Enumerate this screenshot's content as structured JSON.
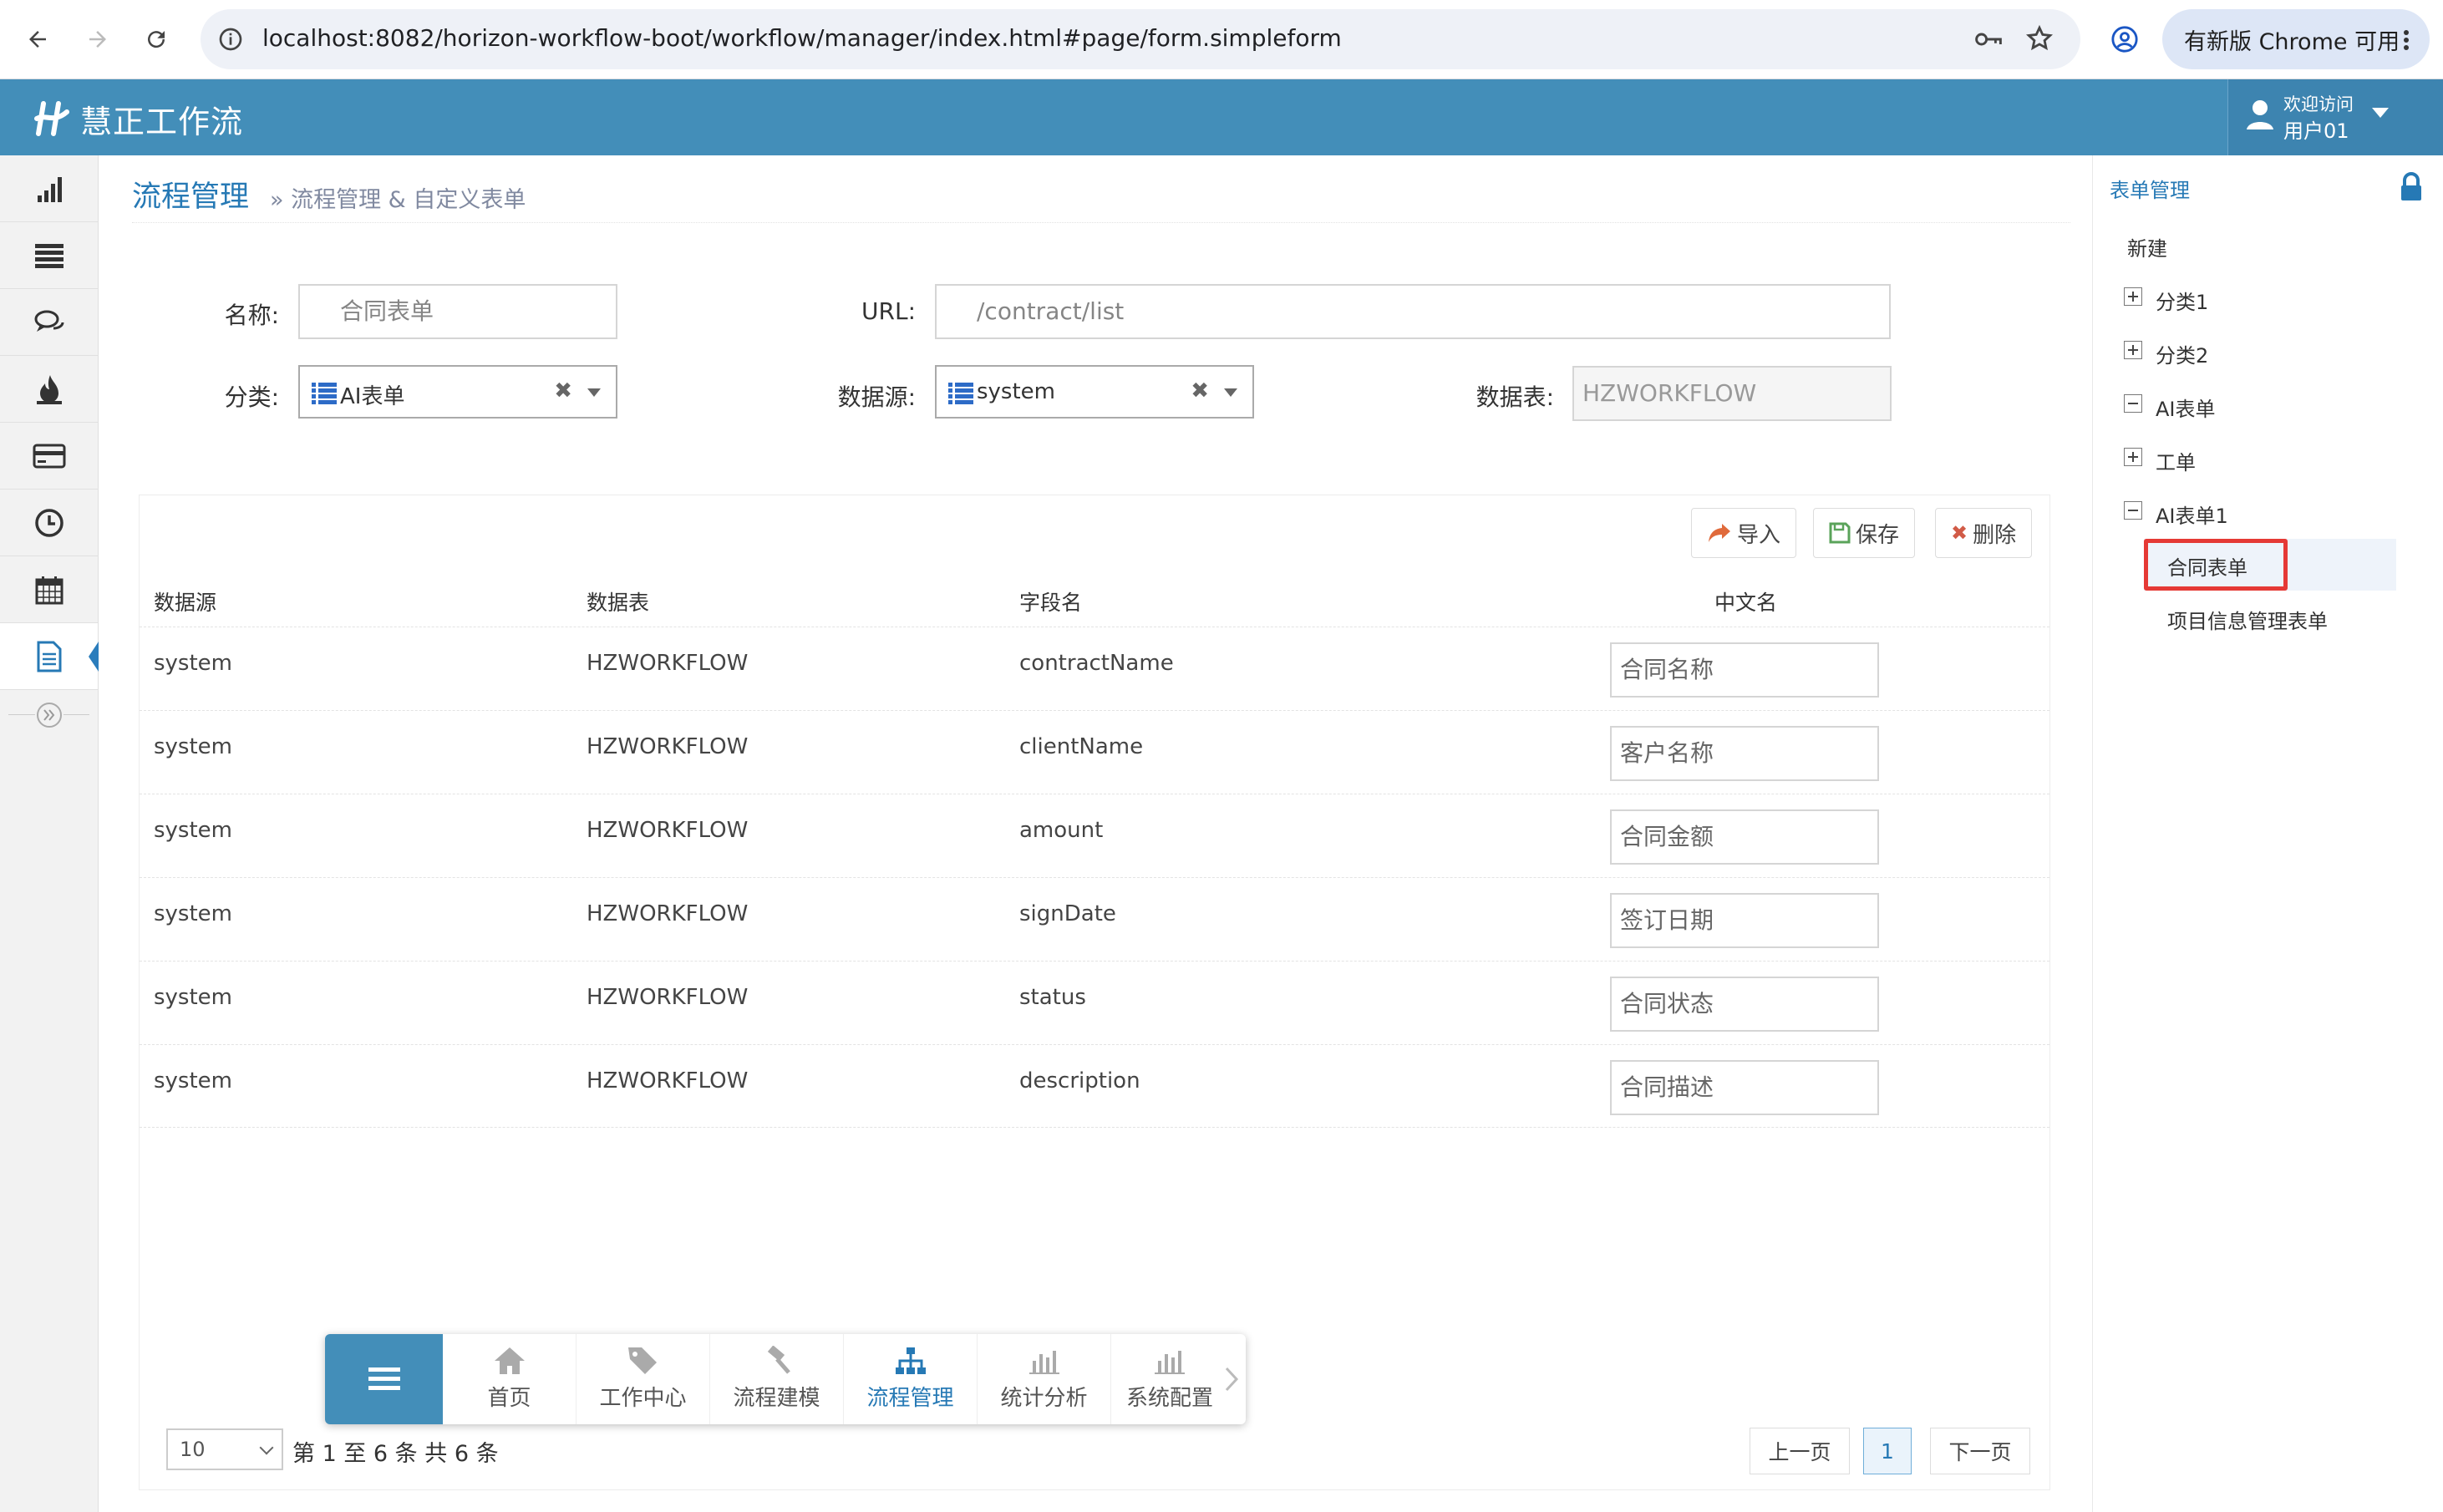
{
  "browser": {
    "url": "localhost:8082/horizon-workflow-boot/workflow/manager/index.html#page/form.simpleform",
    "update_label": "有新版 Chrome 可用"
  },
  "app": {
    "brand": "慧正工作流",
    "user_greeting": "欢迎访问",
    "user_name": "用户01",
    "header_color": "#438eb9"
  },
  "sidebar_icons": [
    "bar-chart-icon",
    "list-icon",
    "comments-icon",
    "fire-icon",
    "credit-card-icon",
    "clock-icon",
    "calendar-icon",
    "file-text-icon",
    "double-angle-right-icon"
  ],
  "breadcrumb": {
    "main": "流程管理",
    "sub": "» 流程管理 & 自定义表单"
  },
  "form": {
    "name_label": "名称:",
    "name_value": "合同表单",
    "url_label": "URL:",
    "url_value": "/contract/list",
    "category_label": "分类:",
    "category_value": "AI表单",
    "datasource_label": "数据源:",
    "datasource_value": "system",
    "datatable_label": "数据表:",
    "datatable_value": "HZWORKFLOW"
  },
  "toolbar": {
    "import_label": "导入",
    "save_label": "保存",
    "delete_label": "删除"
  },
  "table": {
    "headers": [
      "数据源",
      "数据表",
      "字段名",
      "中文名"
    ],
    "rows": [
      {
        "source": "system",
        "table": "HZWORKFLOW",
        "field": "contractName",
        "cn": "合同名称"
      },
      {
        "source": "system",
        "table": "HZWORKFLOW",
        "field": "clientName",
        "cn": "客户名称"
      },
      {
        "source": "system",
        "table": "HZWORKFLOW",
        "field": "amount",
        "cn": "合同金额"
      },
      {
        "source": "system",
        "table": "HZWORKFLOW",
        "field": "signDate",
        "cn": "签订日期"
      },
      {
        "source": "system",
        "table": "HZWORKFLOW",
        "field": "status",
        "cn": "合同状态"
      },
      {
        "source": "system",
        "table": "HZWORKFLOW",
        "field": "description",
        "cn": "合同描述"
      }
    ]
  },
  "pagination": {
    "page_size": "10",
    "info": "第 1 至 6 条 共 6 条",
    "prev": "上一页",
    "current": "1",
    "next": "下一页"
  },
  "bottom_nav": {
    "items": [
      {
        "label": "首页",
        "icon": "home-icon"
      },
      {
        "label": "工作中心",
        "icon": "tag-icon"
      },
      {
        "label": "流程建模",
        "icon": "gavel-icon"
      },
      {
        "label": "流程管理",
        "icon": "sitemap-icon"
      },
      {
        "label": "统计分析",
        "icon": "bar-chart-icon"
      },
      {
        "label": "系统配置",
        "icon": "bar-chart-icon"
      }
    ],
    "active": "流程管理"
  },
  "tree": {
    "title": "表单管理",
    "new_label": "新建",
    "nodes": [
      {
        "label": "分类1",
        "state": "collapsed"
      },
      {
        "label": "分类2",
        "state": "collapsed"
      },
      {
        "label": "AI表单",
        "state": "expanded"
      },
      {
        "label": "工单",
        "state": "collapsed"
      },
      {
        "label": "AI表单1",
        "state": "expanded"
      }
    ],
    "children": [
      "合同表单",
      "项目信息管理表单"
    ],
    "selected": "合同表单",
    "highlight_color": "#e53935"
  }
}
